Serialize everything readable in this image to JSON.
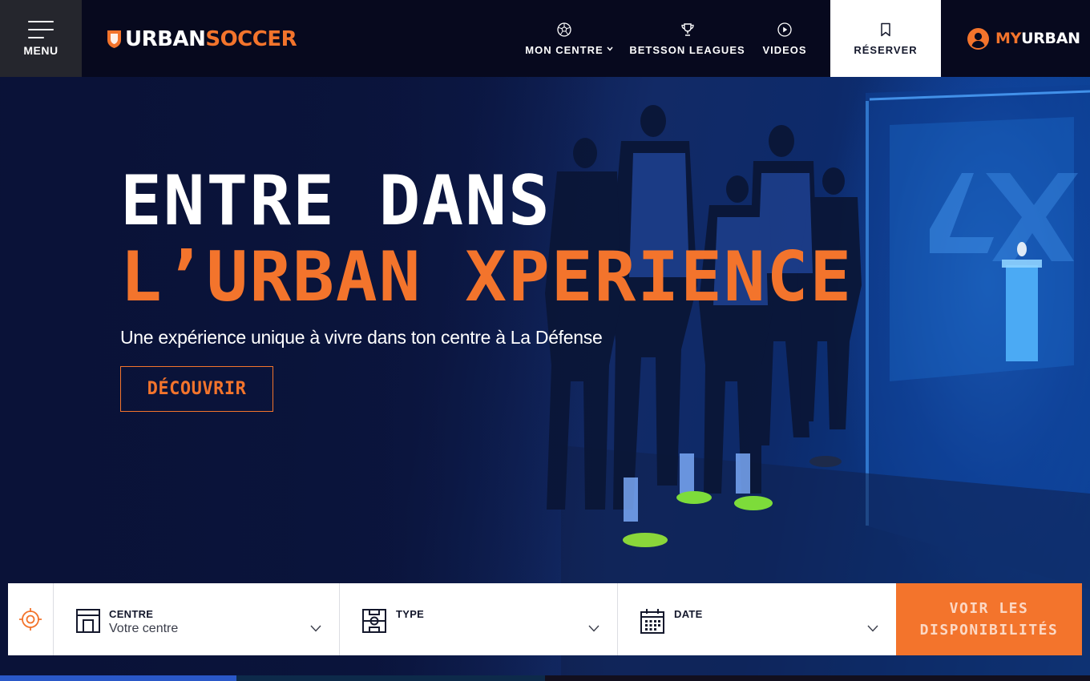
{
  "header": {
    "menu_label": "MENU",
    "logo": {
      "part1": "URBAN",
      "part2": "SOCCER"
    },
    "nav": [
      {
        "label": "MON CENTRE",
        "icon": "soccer-ball-icon",
        "has_dropdown": true
      },
      {
        "label": "BETSSON LEAGUES",
        "icon": "trophy-icon"
      },
      {
        "label": "VIDEOS",
        "icon": "play-icon"
      }
    ],
    "reserve_label": "RÉSERVER",
    "account": {
      "part1": "MY",
      "part2": "URBAN",
      "icon": "user-icon"
    }
  },
  "hero": {
    "title_line1": "ENTRE DANS",
    "title_line2": "L’URBAN XPERIENCE",
    "subtitle": "Une expérience unique à vivre dans ton centre à La Défense",
    "cta_label": "DÉCOUVRIR"
  },
  "booking": {
    "centre": {
      "title": "CENTRE",
      "value": "Votre centre"
    },
    "type": {
      "title": "TYPE",
      "value": ""
    },
    "date": {
      "title": "DATE",
      "value": ""
    },
    "submit_label": "VOIR LES DISPONIBILITÉS"
  },
  "colors": {
    "accent": "#f3742c",
    "header_bg": "#07091e",
    "hero_bg": "#0b1540"
  }
}
